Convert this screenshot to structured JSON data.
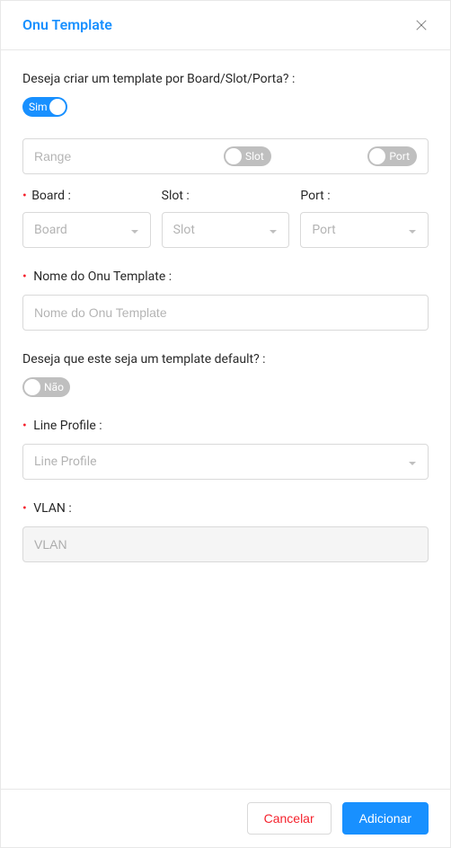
{
  "header": {
    "title": "Onu Template"
  },
  "form": {
    "create_by_bsp": {
      "label": "Deseja criar um template por Board/Slot/Porta? :",
      "switch_on_text": "Sim"
    },
    "range": {
      "placeholder": "Range",
      "slot_switch_text": "Slot",
      "port_switch_text": "Port"
    },
    "board": {
      "label": "Board :",
      "placeholder": "Board"
    },
    "slot": {
      "label": "Slot :",
      "placeholder": "Slot"
    },
    "port": {
      "label": "Port :",
      "placeholder": "Port"
    },
    "template_name": {
      "label": "Nome do Onu Template :",
      "placeholder": "Nome do Onu Template"
    },
    "default_template": {
      "label": "Deseja que este seja um template default? :",
      "switch_off_text": "Não"
    },
    "line_profile": {
      "label": "Line Profile :",
      "placeholder": "Line Profile"
    },
    "vlan": {
      "label": "VLAN :",
      "placeholder": "VLAN"
    }
  },
  "footer": {
    "cancel": "Cancelar",
    "add": "Adicionar"
  }
}
